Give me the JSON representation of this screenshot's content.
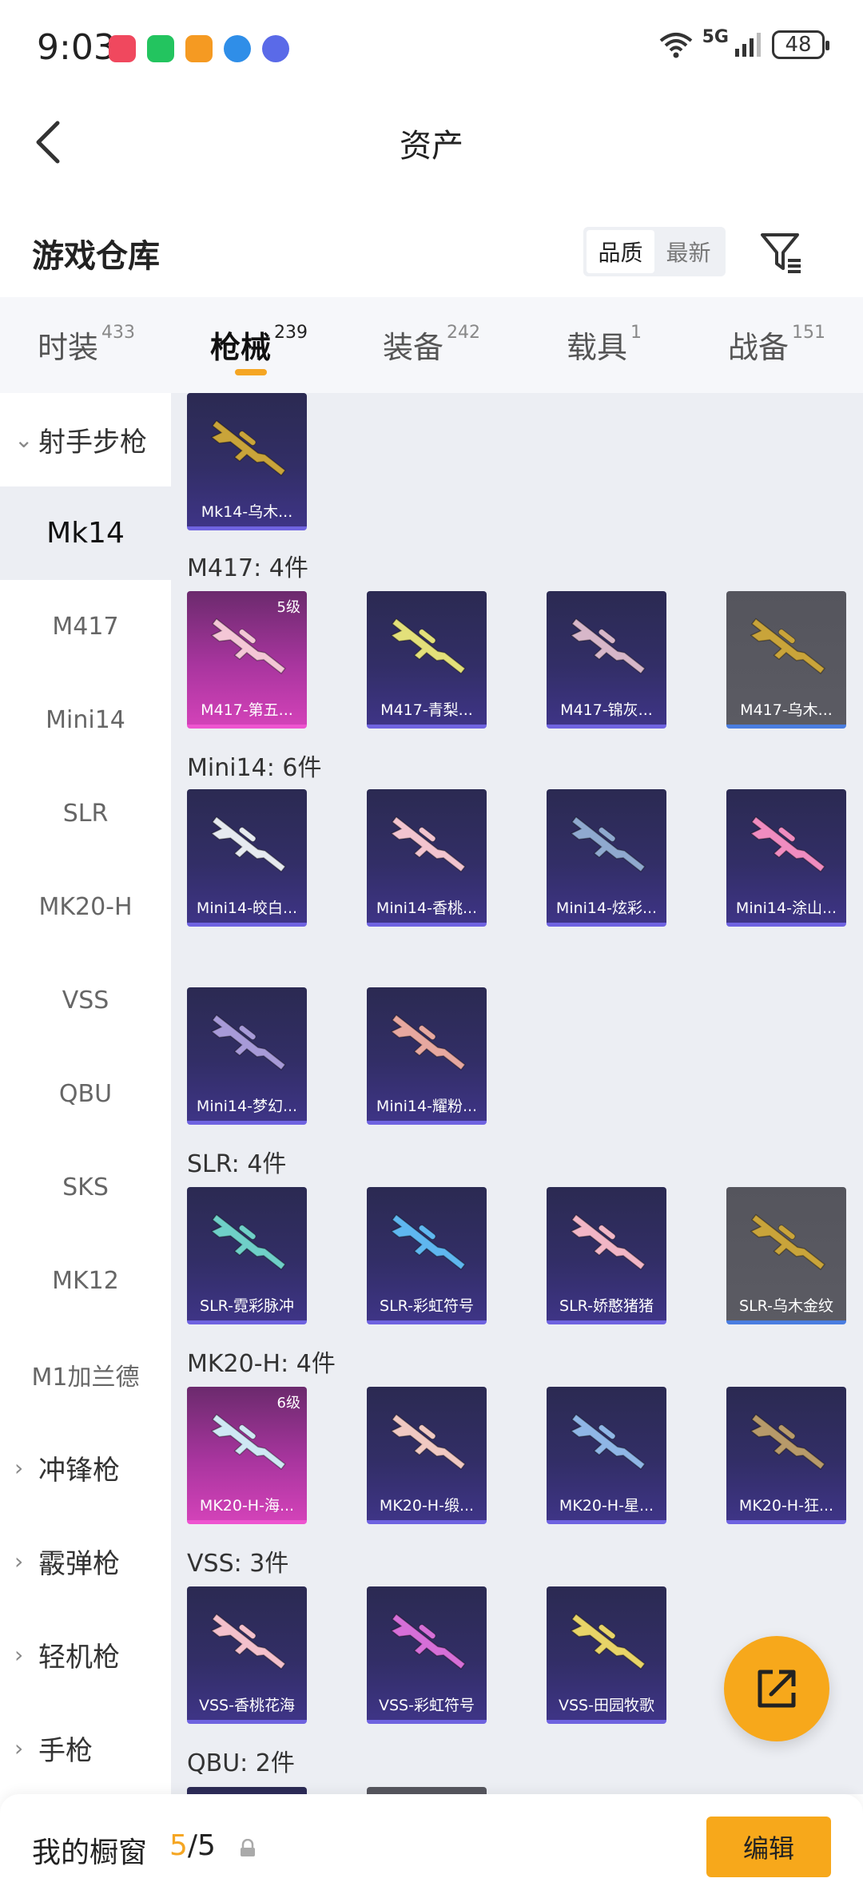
{
  "status_bar": {
    "time": "9:03",
    "network": "5G",
    "battery": "48"
  },
  "header": {
    "title": "资产"
  },
  "section": {
    "title": "游戏仓库",
    "sort_options": [
      "品质",
      "最新"
    ]
  },
  "tabs": [
    {
      "label": "时装",
      "count": "433"
    },
    {
      "label": "枪械",
      "count": "239"
    },
    {
      "label": "装备",
      "count": "242"
    },
    {
      "label": "载具",
      "count": "1"
    },
    {
      "label": "战备",
      "count": "151"
    }
  ],
  "sidebar": {
    "items": [
      {
        "label": "射手步枪",
        "type": "group",
        "chevron": "⌄"
      },
      {
        "label": "Mk14",
        "type": "item"
      },
      {
        "label": "M417",
        "type": "item"
      },
      {
        "label": "Mini14",
        "type": "item"
      },
      {
        "label": "SLR",
        "type": "item"
      },
      {
        "label": "MK20-H",
        "type": "item"
      },
      {
        "label": "VSS",
        "type": "item"
      },
      {
        "label": "QBU",
        "type": "item"
      },
      {
        "label": "SKS",
        "type": "item"
      },
      {
        "label": "MK12",
        "type": "item"
      },
      {
        "label": "M1加兰德",
        "type": "item"
      },
      {
        "label": "冲锋枪",
        "type": "group",
        "chevron": "›"
      },
      {
        "label": "霰弹枪",
        "type": "group",
        "chevron": "›"
      },
      {
        "label": "轻机枪",
        "type": "group",
        "chevron": "›"
      },
      {
        "label": "手枪",
        "type": "group",
        "chevron": "›"
      }
    ]
  },
  "groups": [
    {
      "label": "M417: 4件"
    },
    {
      "label": "Mini14: 6件"
    },
    {
      "label": "SLR: 4件"
    },
    {
      "label": "MK20-H: 4件"
    },
    {
      "label": "VSS: 3件"
    },
    {
      "label": "QBU: 2件"
    }
  ],
  "cards": [
    {
      "name": "Mk14-乌木...",
      "rarity": "blue",
      "gun_color": "#c9a43a"
    },
    {
      "name": "M417-第五...",
      "rarity": "pink",
      "gun_color": "#f4c7d6",
      "level": "5级"
    },
    {
      "name": "M417-青梨...",
      "rarity": "blue",
      "gun_color": "#e3e07a"
    },
    {
      "name": "M417-锦灰...",
      "rarity": "blue",
      "gun_color": "#d7b7c9"
    },
    {
      "name": "M417-乌木...",
      "rarity": "gray",
      "gun_color": "#c9a43a"
    },
    {
      "name": "Mini14-皎白...",
      "rarity": "blue",
      "gun_color": "#e6eaf0"
    },
    {
      "name": "Mini14-香桃...",
      "rarity": "blue",
      "gun_color": "#f2c4cf"
    },
    {
      "name": "Mini14-炫彩...",
      "rarity": "blue",
      "gun_color": "#8fa9cf"
    },
    {
      "name": "Mini14-涂山...",
      "rarity": "blue",
      "gun_color": "#f08cc0"
    },
    {
      "name": "Mini14-梦幻...",
      "rarity": "blue",
      "gun_color": "#a79ad8"
    },
    {
      "name": "Mini14-耀粉...",
      "rarity": "blue",
      "gun_color": "#e7a8a0"
    },
    {
      "name": "SLR-霓彩脉冲",
      "rarity": "blue",
      "gun_color": "#6fd0c8"
    },
    {
      "name": "SLR-彩虹符号",
      "rarity": "blue",
      "gun_color": "#5fb7f0"
    },
    {
      "name": "SLR-娇憨猪猪",
      "rarity": "blue",
      "gun_color": "#f2b6c6"
    },
    {
      "name": "SLR-乌木金纹",
      "rarity": "gray",
      "gun_color": "#c9a43a"
    },
    {
      "name": "MK20-H-海...",
      "rarity": "pink",
      "gun_color": "#cfe8f4",
      "level": "6级"
    },
    {
      "name": "MK20-H-缎...",
      "rarity": "blue",
      "gun_color": "#f0c9c2"
    },
    {
      "name": "MK20-H-星...",
      "rarity": "blue",
      "gun_color": "#8fb6e6"
    },
    {
      "name": "MK20-H-狂...",
      "rarity": "blue",
      "gun_color": "#b79a6a"
    },
    {
      "name": "VSS-香桃花海",
      "rarity": "blue",
      "gun_color": "#f4c0cc"
    },
    {
      "name": "VSS-彩虹符号",
      "rarity": "blue",
      "gun_color": "#d66fd8"
    },
    {
      "name": "VSS-田园牧歌",
      "rarity": "blue",
      "gun_color": "#e8d468"
    }
  ],
  "bottom_bar": {
    "label": "我的橱窗",
    "count_used": "5",
    "count_total": "/5",
    "edit_label": "编辑"
  },
  "colors": {
    "accent": "#f7a81b",
    "card_blue": "#322e66",
    "card_pink": "#c03ab0",
    "card_gray": "#5b5b63"
  }
}
